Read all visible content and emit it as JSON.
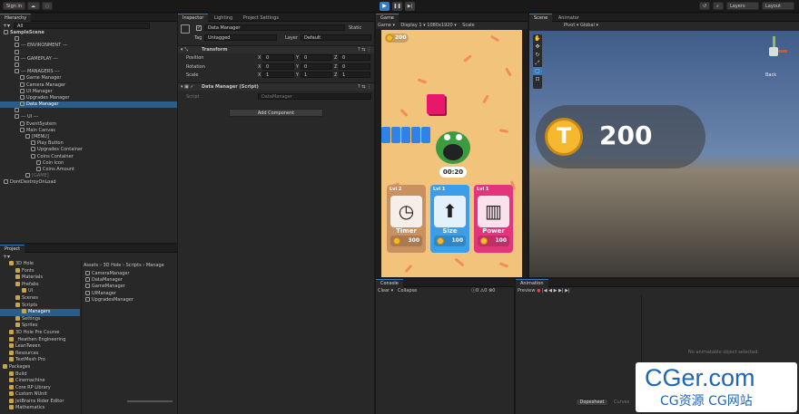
{
  "topbar": {
    "signin": "Sign in",
    "layers": "Layers",
    "layout": "Layout"
  },
  "hierarchy": {
    "tab": "Hierarchy",
    "search": "All",
    "items": [
      {
        "label": "SampleScene",
        "indent": 0,
        "bold": true
      },
      {
        "label": "",
        "indent": 2
      },
      {
        "label": "--- ENVIRONMENT ---",
        "indent": 2
      },
      {
        "label": "",
        "indent": 2
      },
      {
        "label": "--- GAMEPLAY ---",
        "indent": 2
      },
      {
        "label": "",
        "indent": 2
      },
      {
        "label": "--- MANAGERS ---",
        "indent": 2
      },
      {
        "label": "Game Manager",
        "indent": 3
      },
      {
        "label": "Camera Manager",
        "indent": 3
      },
      {
        "label": "UI Manager",
        "indent": 3
      },
      {
        "label": "Upgrades Manager",
        "indent": 3
      },
      {
        "label": "Data Manager",
        "indent": 3,
        "selected": true
      },
      {
        "label": "",
        "indent": 2
      },
      {
        "label": "--- UI ---",
        "indent": 2
      },
      {
        "label": "EventSystem",
        "indent": 3
      },
      {
        "label": "Main Canvas",
        "indent": 3
      },
      {
        "label": "[MENU]",
        "indent": 4
      },
      {
        "label": "Play Button",
        "indent": 5
      },
      {
        "label": "Upgrades Container",
        "indent": 5
      },
      {
        "label": "Coins Container",
        "indent": 5
      },
      {
        "label": "Coin Icon",
        "indent": 6
      },
      {
        "label": "Coins Amount",
        "indent": 6
      },
      {
        "label": "[GAME]",
        "indent": 4,
        "dim": true
      },
      {
        "label": "DontDestroyOnLoad",
        "indent": 0
      }
    ]
  },
  "inspector": {
    "tabs": [
      "Inspector",
      "Lighting",
      "Project Settings"
    ],
    "object_name": "Data Manager",
    "static": "Static",
    "tag_label": "Tag",
    "tag": "Untagged",
    "layer_label": "Layer",
    "layer": "Default",
    "transform": {
      "title": "Transform",
      "rows": [
        {
          "label": "Position",
          "x": "0",
          "y": "0",
          "z": "0"
        },
        {
          "label": "Rotation",
          "x": "0",
          "y": "0",
          "z": "0"
        },
        {
          "label": "Scale",
          "x": "1",
          "y": "1",
          "z": "1"
        }
      ]
    },
    "script_comp": {
      "title": "Data Manager (Script)",
      "script_label": "Script",
      "script_value": "DataManager"
    },
    "add_component": "Add Component"
  },
  "game": {
    "tab": "Game",
    "display_mode": "Game",
    "display": "Display 1",
    "resolution": "1080x1920",
    "scale": "Scale",
    "coins": "200",
    "timer": "00:20",
    "cards": [
      {
        "level": "Lvl 2",
        "name": "Timer",
        "price": "300",
        "icon": "clock-icon",
        "color": "#c99060"
      },
      {
        "level": "Lvl 1",
        "name": "Size",
        "price": "100",
        "icon": "arrow-up-icon",
        "color": "#3c9ee8"
      },
      {
        "level": "Lvl 1",
        "name": "Power",
        "price": "100",
        "icon": "battery-icon",
        "color": "#e2357c"
      }
    ]
  },
  "scene": {
    "tabs": [
      "Scene",
      "Animator"
    ],
    "pivot": "Pivot",
    "global": "Global",
    "coins": "200",
    "back": "Back"
  },
  "project": {
    "tab": "Project",
    "tree": [
      {
        "label": "3D Hole",
        "indent": 1
      },
      {
        "label": "Fonts",
        "indent": 2
      },
      {
        "label": "Materials",
        "indent": 2
      },
      {
        "label": "Prefabs",
        "indent": 2
      },
      {
        "label": "UI",
        "indent": 3
      },
      {
        "label": "Scenes",
        "indent": 2
      },
      {
        "label": "Scripts",
        "indent": 2
      },
      {
        "label": "Managers",
        "indent": 3,
        "selected": true
      },
      {
        "label": "Settings",
        "indent": 2
      },
      {
        "label": "Sprites",
        "indent": 2
      },
      {
        "label": "3D Hole Pre Course",
        "indent": 1
      },
      {
        "label": "_Heathen Engineering",
        "indent": 1
      },
      {
        "label": "LeanTween",
        "indent": 1
      },
      {
        "label": "Resources",
        "indent": 1
      },
      {
        "label": "TextMesh Pro",
        "indent": 1
      },
      {
        "label": "Packages",
        "indent": 0
      },
      {
        "label": "Build",
        "indent": 1
      },
      {
        "label": "Cinemachine",
        "indent": 1
      },
      {
        "label": "Core RP Library",
        "indent": 1
      },
      {
        "label": "Custom NUnit",
        "indent": 1
      },
      {
        "label": "JetBrains Rider Editor",
        "indent": 1
      },
      {
        "label": "Mathematics",
        "indent": 1
      }
    ],
    "breadcrumb": [
      "Assets",
      "3D Hole",
      "Scripts",
      "Manage"
    ],
    "files": [
      "CameraManager",
      "DataManager",
      "GameManager",
      "UIManager",
      "UpgradesManager"
    ]
  },
  "console": {
    "tab": "Console",
    "clear": "Clear",
    "collapse": "Collapse",
    "errors": "0",
    "warnings": "0",
    "logs": "0"
  },
  "animation": {
    "tab": "Animation",
    "preview": "Preview",
    "empty": "No animatable object selected.",
    "dopesheet": "Dopesheet",
    "curves": "Curves"
  },
  "watermark": {
    "line1": "CGer.com",
    "line2": "CG资源 CG网站"
  },
  "colors": {
    "accent": "#2c5d87",
    "game_bg": "#f2c37a",
    "coin": "#f5b82e"
  }
}
